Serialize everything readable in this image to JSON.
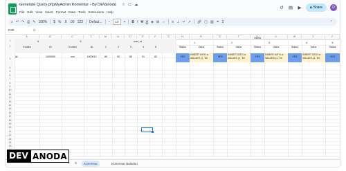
{
  "doc": {
    "title": "Generate Query phpMyAdmin Komentar - By DEVanoda"
  },
  "menu": [
    "File",
    "Edit",
    "View",
    "Insert",
    "Format",
    "Data",
    "Tools",
    "Extensions",
    "Help"
  ],
  "share_label": "Share",
  "toolbar": {
    "zoom": "100%",
    "currency": "$",
    "percent": "%",
    "font": "Defaul...",
    "font_size": "10"
  },
  "formula": {
    "namebox": "R30",
    "fx": "fx"
  },
  "columns": [
    "A",
    "B",
    "C",
    "L",
    "M",
    "N",
    "D",
    "E",
    "F",
    "G",
    "H",
    "R",
    "S",
    "T",
    "U",
    "V",
    "W",
    "X",
    "Y",
    "Z",
    "AA",
    "AB"
  ],
  "rows": [
    "1",
    "2",
    "3",
    "4",
    "5",
    "6",
    "7",
    "8",
    "9",
    "10",
    "11",
    "12",
    "13",
    "14",
    "15",
    "16",
    "17",
    "18",
    "19",
    "20",
    "21",
    "22",
    "23",
    "24",
    "25",
    "26",
    "27",
    "28",
    "29",
    "30",
    "31",
    "32"
  ],
  "headers": {
    "group_a": "#",
    "group_b": "5",
    "group_user": "user_id",
    "group_hasil": "HASIL",
    "row2": [
      "Konten",
      "ID",
      "Konten",
      "ID",
      "1",
      "2",
      "3",
      "4",
      "5"
    ],
    "hasil_nums": [
      "1",
      "2",
      "3",
      "4",
      "5"
    ],
    "status": "Status",
    "value": "Value"
  },
  "row3": {
    "konten": "jkl",
    "id1": "1000009",
    "konten2": "nnn",
    "id2": "1000010",
    "vals": [
      "80",
      "90",
      "80",
      "91",
      "82"
    ],
    "yes": "YES",
    "insert": "INSERT INTO w",
    "values_line": "VALUES (1, 'bh"
  },
  "sheet": {
    "tab_active": "Komentar",
    "tab2": "Komentar Balasan"
  },
  "watermark": {
    "part1": "DEV",
    "part2": "ANODA"
  }
}
